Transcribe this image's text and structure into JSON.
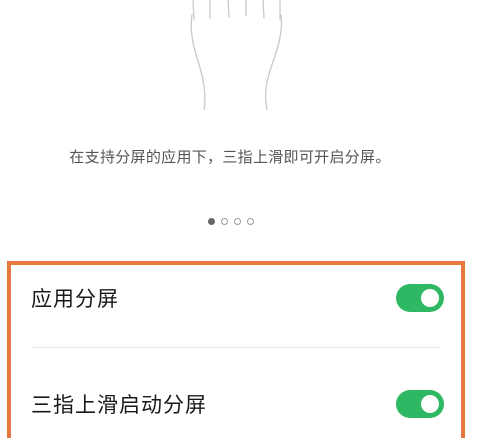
{
  "illustration": {
    "icon": "hand-swipe-icon"
  },
  "hint": {
    "text": "在支持分屏的应用下，三指上滑即可开启分屏。"
  },
  "pager": {
    "count": 4,
    "active_index": 0
  },
  "settings": {
    "items": [
      {
        "label": "应用分屏",
        "enabled": true
      },
      {
        "label": "三指上滑启动分屏",
        "enabled": true
      }
    ]
  },
  "colors": {
    "toggle_on": "#2fb864",
    "highlight_border": "#e8773e"
  }
}
